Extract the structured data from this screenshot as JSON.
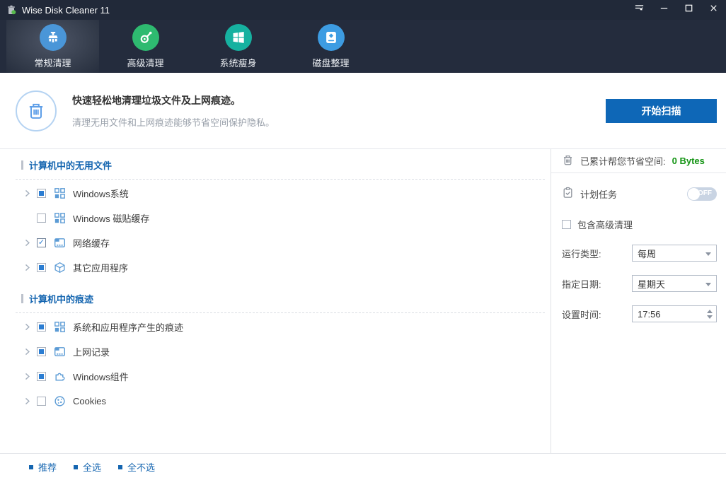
{
  "window": {
    "title": "Wise Disk Cleaner 11"
  },
  "nav": {
    "tabs": [
      {
        "name": "common-clean",
        "label": "常规清理",
        "icon": "brush-icon",
        "color": "#4a96d8",
        "active": true
      },
      {
        "name": "advanced-clean",
        "label": "高级清理",
        "icon": "vacuum-icon",
        "color": "#2eba70",
        "active": false
      },
      {
        "name": "system-slim",
        "label": "系统瘦身",
        "icon": "windows-logo-icon",
        "color": "#16b1a0",
        "active": false
      },
      {
        "name": "disk-defrag",
        "label": "磁盘整理",
        "icon": "disk-icon",
        "color": "#3d9ce2",
        "active": false
      }
    ]
  },
  "header": {
    "title": "快速轻松地清理垃圾文件及上网痕迹。",
    "subtitle": "清理无用文件和上网痕迹能够节省空间保护隐私。",
    "scan_button": "开始扫描"
  },
  "tree": {
    "sections": [
      {
        "title": "计算机中的无用文件",
        "items": [
          {
            "label": "Windows系统",
            "icon": "windows-tiles-icon",
            "checkbox": "partial",
            "expandable": true
          },
          {
            "label": "Windows 磁贴缓存",
            "icon": "windows-tiles-icon",
            "checkbox": "unchecked",
            "expandable": false
          },
          {
            "label": "网络缓存",
            "icon": "browser-cache-icon",
            "checkbox": "checked",
            "expandable": true
          },
          {
            "label": "其它应用程序",
            "icon": "app-box-icon",
            "checkbox": "partial",
            "expandable": true
          }
        ]
      },
      {
        "title": "计算机中的痕迹",
        "items": [
          {
            "label": "系统和应用程序产生的痕迹",
            "icon": "windows-tiles-icon",
            "checkbox": "partial",
            "expandable": true
          },
          {
            "label": "上网记录",
            "icon": "browser-cache-icon",
            "checkbox": "partial",
            "expandable": true
          },
          {
            "label": "Windows组件",
            "icon": "puzzle-icon",
            "checkbox": "partial",
            "expandable": true
          },
          {
            "label": "Cookies",
            "icon": "cookie-icon",
            "checkbox": "unchecked",
            "expandable": true
          }
        ]
      }
    ]
  },
  "panel": {
    "saved_label": "已累计帮您节省空间:",
    "saved_value": "0 Bytes",
    "schedule": {
      "label": "计划任务",
      "toggle_state": "OFF"
    },
    "include_advanced_label": "包含高级清理",
    "run_type": {
      "label": "运行类型:",
      "value": "每周"
    },
    "day": {
      "label": "指定日期:",
      "value": "星期天"
    },
    "time": {
      "label": "设置时间:",
      "value": "17:56"
    }
  },
  "footer": {
    "links": [
      "推荐",
      "全选",
      "全不选"
    ]
  },
  "colors": {
    "accent_blue": "#0e67b7",
    "saved_green": "#149414",
    "section_blue": "#1465b0",
    "tree_icon_blue": "#5b9bd5",
    "titlebar_bg": "#212939",
    "navbar_bg": "#242c3d"
  }
}
